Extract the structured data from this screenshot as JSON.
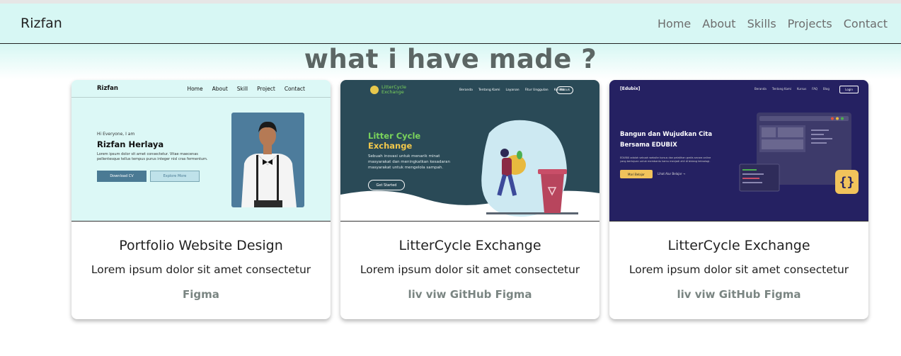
{
  "navbar": {
    "brand": "Rizfan",
    "links": [
      "Home",
      "About",
      "Skills",
      "Projects",
      "Contact"
    ]
  },
  "section": {
    "title": "what i have made ?"
  },
  "cards": [
    {
      "title": "Portfolio Website Design",
      "text": "Lorem ipsum dolor sit amet consectetur",
      "links": [
        "Figma"
      ],
      "preview": {
        "brand": "Rizfan",
        "nav": [
          "Home",
          "About",
          "Skill",
          "Project",
          "Contact"
        ],
        "greeting": "Hi Everyone, I am",
        "name": "Rizfan Herlaya",
        "lorem": "Lorem ipsum dolor sit amet consectetur. Vitae maecenas pellentesque tellus tempus purus integer nisl cras fermentum.",
        "btn_primary": "Download CV",
        "btn_secondary": "Explore More"
      }
    },
    {
      "title": "LitterCycle Exchange",
      "text": "Lorem ipsum dolor sit amet consectetur",
      "links": [
        "liv viw",
        "GitHub",
        "Figma"
      ],
      "preview": {
        "logo_line1": "LitterCycle",
        "logo_line2": "Exchange",
        "nav": [
          "Beranda",
          "Tentang Kami",
          "Layanan",
          "Fitur Unggulan",
          "Kontak"
        ],
        "nav_button": "Masuk",
        "headline_1": "Litter Cycle",
        "headline_2": "Exchange",
        "desc": "Sebuah inovasi untuk menarik minat masyarakat dan meningkatkan kesadaran masyarakat untuk mengelola sampah.",
        "button": "Get Started"
      }
    },
    {
      "title": "LitterCycle Exchange",
      "text": "Lorem ipsum dolor sit amet consectetur",
      "links": [
        "liv viw",
        "GitHub",
        "Figma"
      ],
      "preview": {
        "brand": "[Edubix]",
        "nav": [
          "Beranda",
          "Tentang Kami",
          "Kursus",
          "FAQ",
          "Blog"
        ],
        "nav_button": "Login",
        "headline": "Bangun dan Wujudkan Cita Bersama EDUBIX",
        "desc": "EDUBIX adalah sebuah website kursus dan pelatihan gratis secara online yang bertujuan untuk membantu kamu menjadi ahli di bidang teknologi.",
        "btn_primary": "Mari Belajar",
        "btn_link": "Lihat Alur Belajar →"
      }
    }
  ],
  "colors": {
    "navbar_bg": "#d7f7f4",
    "title": "#5c6664",
    "link": "#7a8582",
    "p2_accent_green": "#7ad35b",
    "p2_accent_yellow": "#f2c84b",
    "p3_bg": "#252162"
  }
}
